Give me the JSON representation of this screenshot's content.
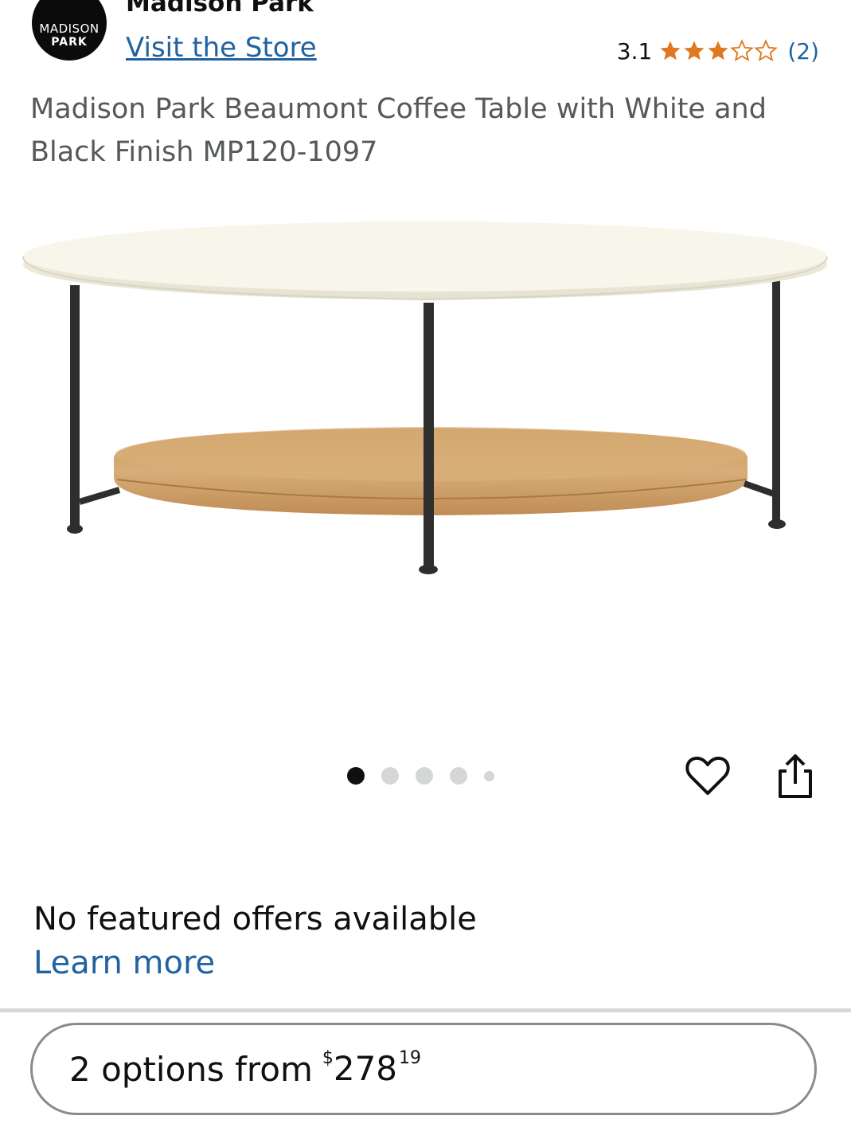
{
  "brand": {
    "logo_line1": "MADISON",
    "logo_line2": "PARK",
    "name": "Madison Park",
    "visit_store_label": "Visit the Store"
  },
  "rating": {
    "value": "3.1",
    "stars_filled": 3,
    "stars_total": 5,
    "count_label": "(2)",
    "star_color": "#de7921"
  },
  "product": {
    "title": "Madison Park Beaumont Coffee Table with White and Black Finish MP120-1097"
  },
  "carousel": {
    "total_dots": 5,
    "active_index": 0
  },
  "actions": {
    "wishlist_icon": "heart-icon",
    "share_icon": "share-icon"
  },
  "offers": {
    "no_offers_text": "No featured offers available",
    "learn_more_label": "Learn more"
  },
  "options_button": {
    "label": "2 options from",
    "price_symbol": "$",
    "price_whole": "278",
    "price_fraction": "19"
  },
  "colors": {
    "link": "#2162a1",
    "text": "#0f1111",
    "muted": "#565959"
  }
}
